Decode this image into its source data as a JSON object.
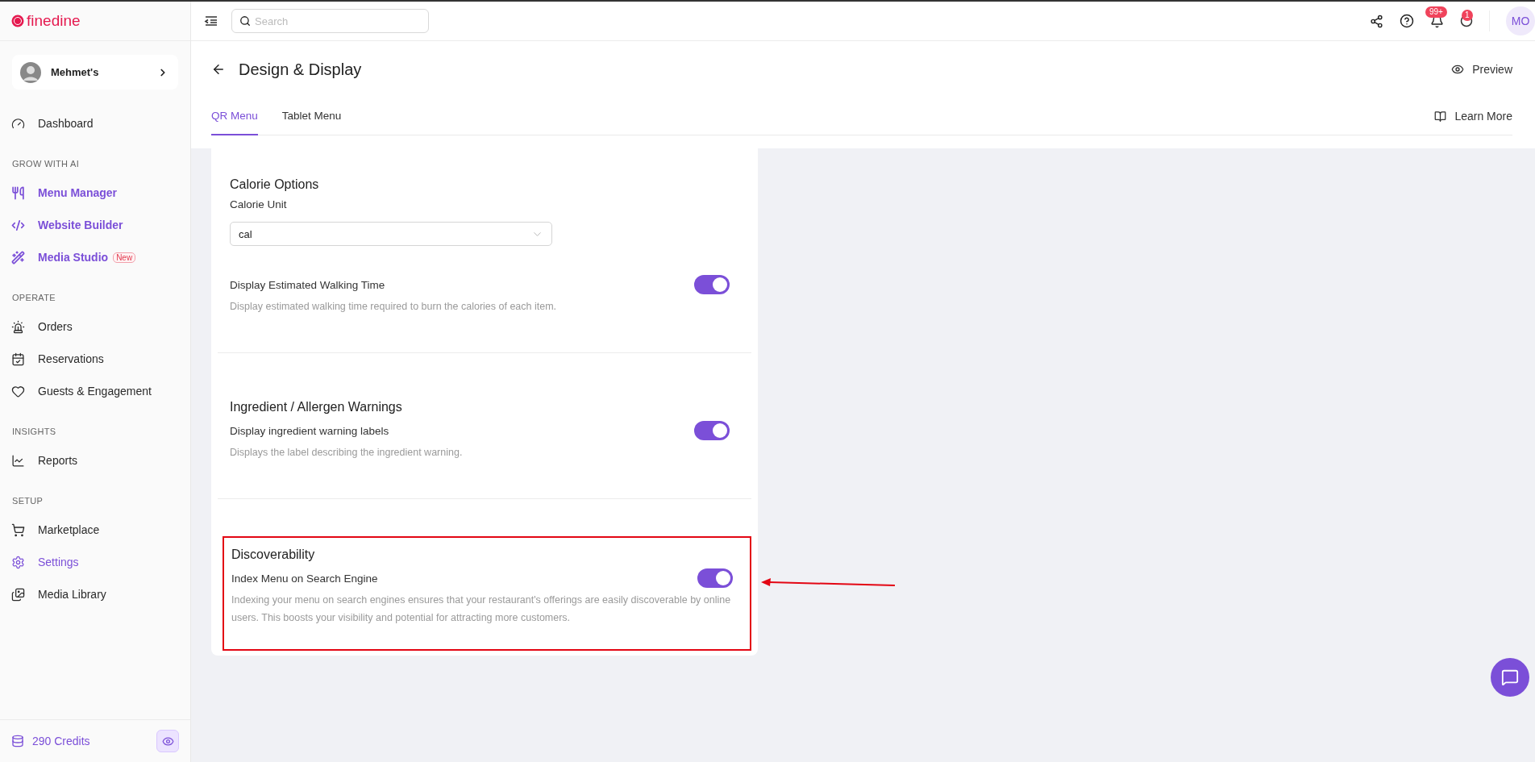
{
  "brand": {
    "name": "finedine"
  },
  "venue": {
    "name": "Mehmet's"
  },
  "sidebar": {
    "sections": [
      {
        "kind": "plain",
        "items": [
          {
            "label": "Dashboard",
            "selected": false
          }
        ]
      },
      {
        "heading": "GROW WITH AI",
        "kind": "ai",
        "items": [
          {
            "label": "Menu Manager",
            "selected": false
          },
          {
            "label": "Website Builder",
            "selected": false
          },
          {
            "label": "Media Studio",
            "selected": false,
            "badge": "New"
          }
        ]
      },
      {
        "heading": "OPERATE",
        "kind": "plain",
        "items": [
          {
            "label": "Orders",
            "selected": false
          },
          {
            "label": "Reservations",
            "selected": false
          },
          {
            "label": "Guests & Engagement",
            "selected": false
          }
        ]
      },
      {
        "heading": "INSIGHTS",
        "kind": "plain",
        "items": [
          {
            "label": "Reports",
            "selected": false
          }
        ]
      },
      {
        "heading": "SETUP",
        "kind": "plain",
        "items": [
          {
            "label": "Marketplace",
            "selected": false
          },
          {
            "label": "Settings",
            "selected": true
          },
          {
            "label": "Media Library",
            "selected": false
          }
        ]
      }
    ]
  },
  "credits": "290 Credits",
  "topbar": {
    "search": {
      "placeholder": "Search"
    },
    "notifications_badge": "99+",
    "messages_badge": "1",
    "avatar": "MO"
  },
  "page": {
    "title": "Design & Display",
    "preview": "Preview",
    "learn_more": "Learn More"
  },
  "tabs": [
    {
      "label": "QR Menu",
      "selected": true
    },
    {
      "label": "Tablet Menu",
      "selected": false
    }
  ],
  "sections": [
    {
      "title": "Calorie Options",
      "highlighted": false,
      "rows": [
        {
          "kind": "select",
          "label": "Calorie Unit",
          "value": "cal"
        },
        {
          "kind": "toggle",
          "label": "Display Estimated Walking Time",
          "description": "Display estimated walking time required to burn the calories of each item.",
          "on": true
        }
      ]
    },
    {
      "title": "Ingredient / Allergen Warnings",
      "highlighted": false,
      "rows": [
        {
          "kind": "toggle",
          "label": "Display ingredient warning labels",
          "description": "Displays the label describing the ingredient warning.",
          "on": true
        }
      ]
    },
    {
      "title": "Discoverability",
      "highlighted": true,
      "rows": [
        {
          "kind": "toggle",
          "label": "Index Menu on Search Engine",
          "description": "Indexing your menu on search engines ensures that your restaurant's offerings are easily discoverable by online users. This boosts your visibility and potential for attracting more customers.",
          "on": true
        }
      ]
    }
  ]
}
